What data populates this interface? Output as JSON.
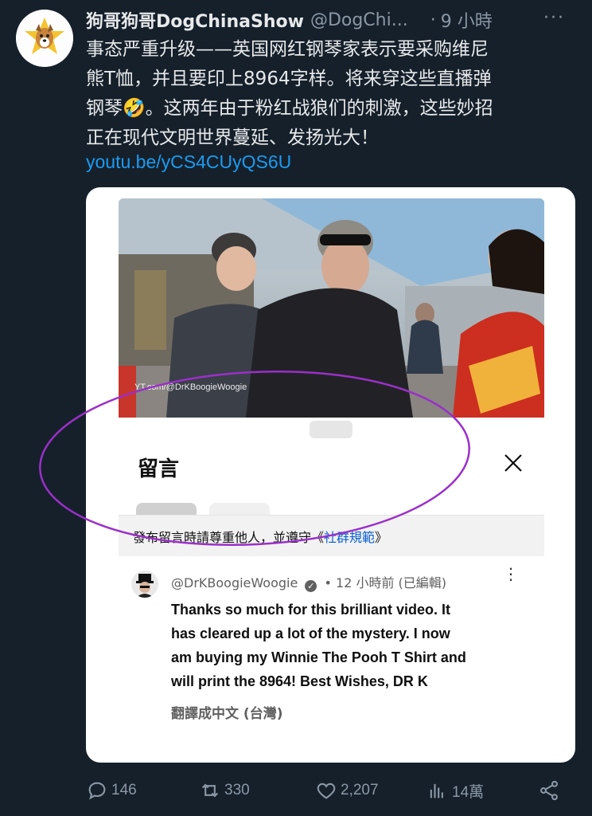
{
  "tweet": {
    "display_name": "狗哥狗哥DogChinaShow",
    "handle": "@DogChi...",
    "separator": "·",
    "time": "9 小時",
    "more": "···",
    "text_lines": [
      "事态严重升级——英国网红钢琴家表示要采购维尼",
      "熊T恤，并且要印上8964字样。将来穿这些直播弹",
      "钢琴🤣。这两年由于粉红战狼们的刺激，这些妙招",
      "正在现代文明世界蔓延、发扬光大！"
    ],
    "link": "youtu.be/yCS4CUyQS6U"
  },
  "video": {
    "watermark": "YT.com/@DrKBoogieWoogie"
  },
  "comments_sheet": {
    "title": "留言",
    "notice_prefix": "發布留言時請尊重他人，並遵守《",
    "notice_link": "社群規範",
    "notice_suffix": "》",
    "comment": {
      "author": "@DrKBoogieWoogie",
      "verified": "✓",
      "meta": "• 12 小時前 (已編輯)",
      "body_lines": [
        "Thanks so much for this brilliant video. It",
        "has cleared up a lot of the mystery. I now",
        "am buying my Winnie The Pooh T Shirt and",
        "will print the 8964! Best Wishes, DR K"
      ],
      "translate": "翻譯成中文 (台灣)"
    }
  },
  "actions": {
    "replies": "146",
    "retweets": "330",
    "likes": "2,207",
    "views": "14萬"
  },
  "colors": {
    "background": "#15202b",
    "link": "#1d9bf0",
    "secondary": "#8b98a5",
    "highlight_ellipse": "#9b2fc9"
  }
}
